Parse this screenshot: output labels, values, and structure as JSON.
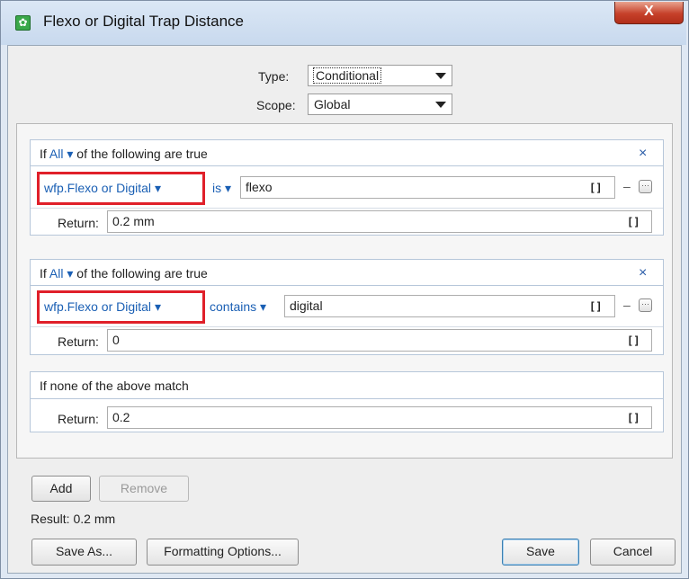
{
  "window": {
    "title": "Flexo or Digital Trap Distance",
    "close_glyph": "X"
  },
  "type_row": {
    "label": "Type:",
    "value": "Conditional"
  },
  "scope_row": {
    "label": "Scope:",
    "value": "Global"
  },
  "rules": [
    {
      "if_word": "If",
      "quantifier": "All",
      "condition_text": "of the following are true",
      "remove_glyph": "×",
      "variable": "wfp.Flexo or Digital",
      "operator": "is",
      "operand": "flexo",
      "return_label": "Return:",
      "return_value": "0.2 mm"
    },
    {
      "if_word": "If",
      "quantifier": "All",
      "condition_text": "of the following are true",
      "remove_glyph": "×",
      "variable": "wfp.Flexo or Digital",
      "operator": "contains",
      "operand": "digital",
      "return_label": "Return:",
      "return_value": "0"
    }
  ],
  "default_rule": {
    "label": "If none of the above match",
    "return_label": "Return:",
    "return_value": "0.2"
  },
  "icons": {
    "dropdown": "▾",
    "brackets": "[]",
    "minus": "–",
    "more": "···"
  },
  "buttons": {
    "add": "Add",
    "remove": "Remove",
    "save_as": "Save As...",
    "formatting_options": "Formatting Options...",
    "save": "Save",
    "cancel": "Cancel"
  },
  "result": {
    "label": "Result:",
    "value": "0.2 mm"
  },
  "colors": {
    "link_blue": "#1a5fb4",
    "highlight_red": "#e0202a",
    "close_red": "#c6402a",
    "panel_border": "#b7c7da"
  }
}
